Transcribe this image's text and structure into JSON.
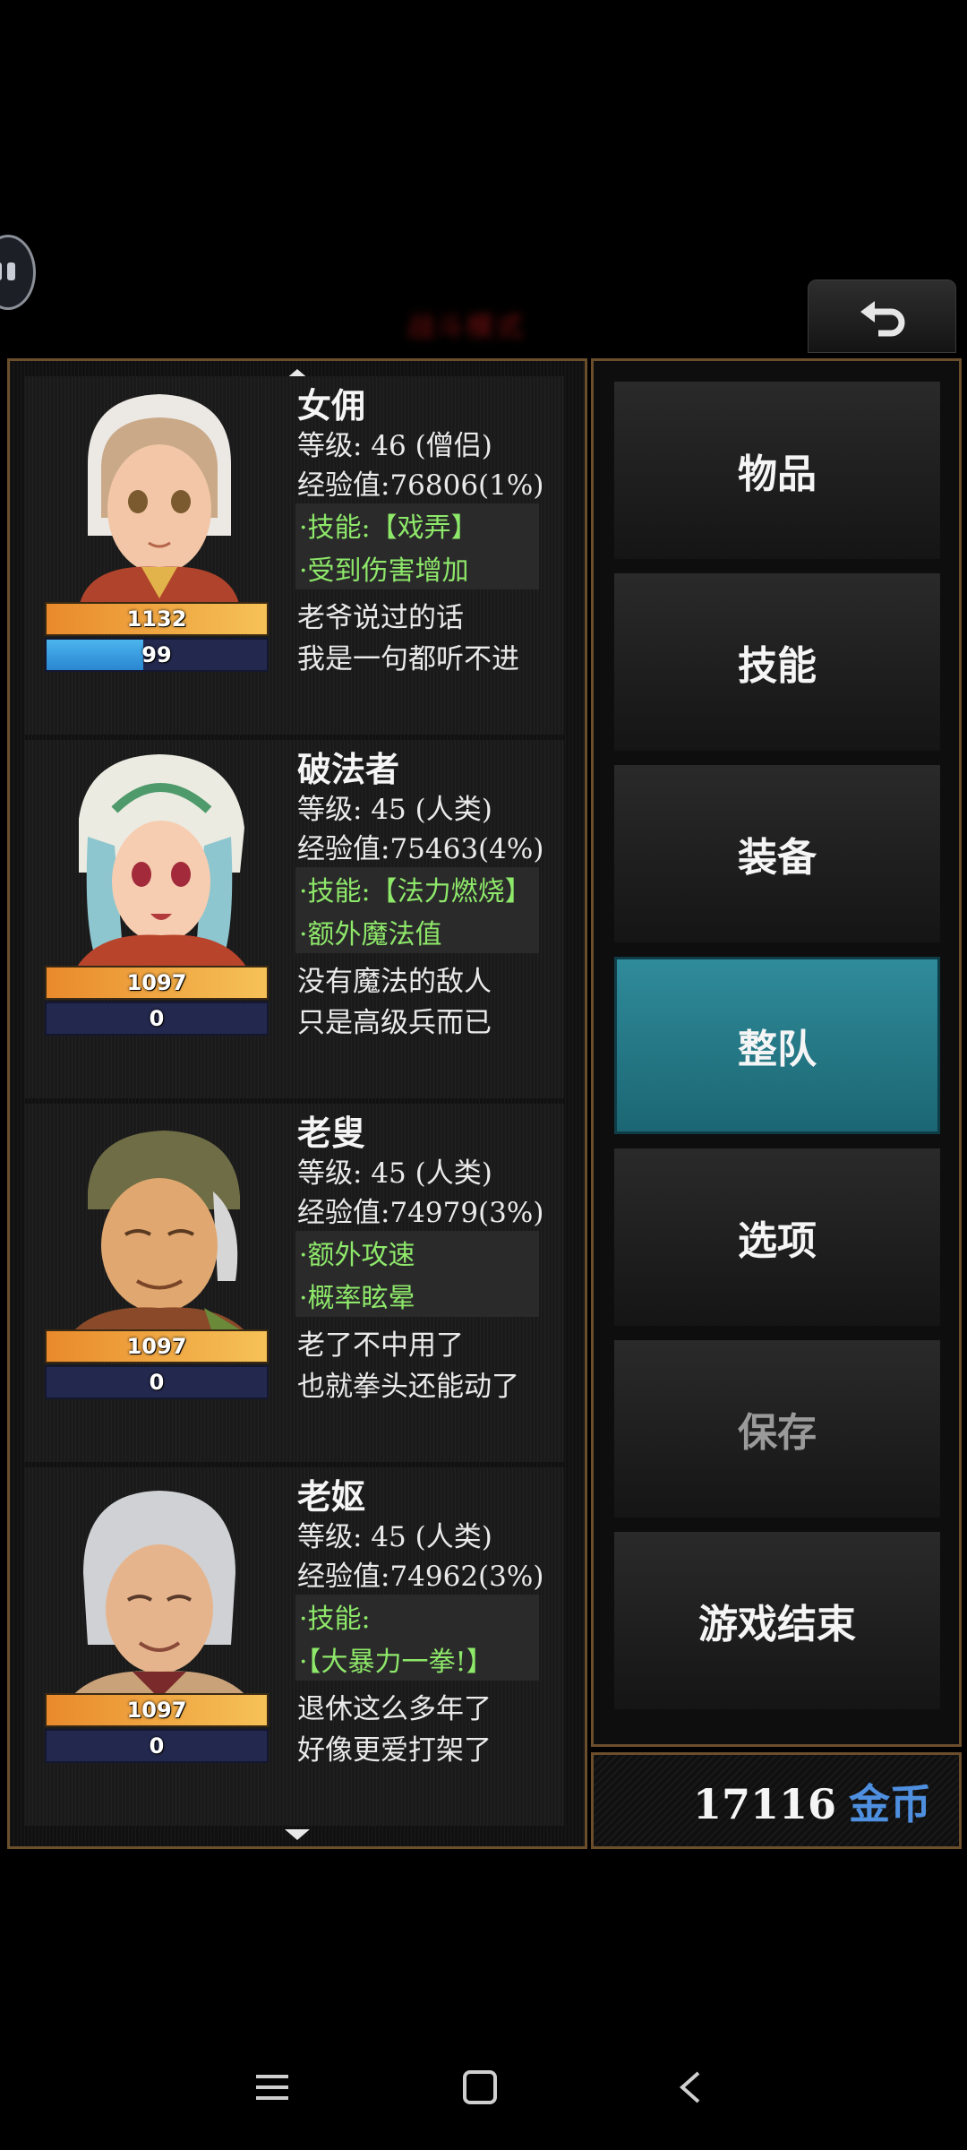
{
  "header": {
    "blurred_title": "战斗模式"
  },
  "characters": [
    {
      "name": "女佣",
      "level": "等级: 46 (僧侣)",
      "exp": "经验值:76806(1%)",
      "skill1": "·技能:【戏弄】",
      "skill2": "·受到伤害增加",
      "quote1": "老爷说过的话",
      "quote2": "我是一句都听不进",
      "hp": "1132",
      "mp": "99",
      "mp_fraction": 0.44
    },
    {
      "name": "破法者",
      "level": "等级: 45 (人类)",
      "exp": "经验值:75463(4%)",
      "skill1": "·技能:【法力燃烧】",
      "skill2": "·额外魔法值",
      "quote1": "没有魔法的敌人",
      "quote2": "只是高级兵而已",
      "hp": "1097",
      "mp": "0",
      "mp_fraction": 0
    },
    {
      "name": "老叟",
      "level": "等级: 45 (人类)",
      "exp": "经验值:74979(3%)",
      "skill1": "·额外攻速",
      "skill2": "·概率眩晕",
      "quote1": "老了不中用了",
      "quote2": "也就拳头还能动了",
      "hp": "1097",
      "mp": "0",
      "mp_fraction": 0
    },
    {
      "name": "老妪",
      "level": "等级: 45 (人类)",
      "exp": "经验值:74962(3%)",
      "skill1": "·技能:",
      "skill2": "·【大暴力一拳!】",
      "quote1": "退休这么多年了",
      "quote2": "好像更爱打架了",
      "hp": "1097",
      "mp": "0",
      "mp_fraction": 0
    }
  ],
  "menu": {
    "items": [
      "物品",
      "技能",
      "装备",
      "整队",
      "选项",
      "保存",
      "游戏结束"
    ],
    "active": "整队",
    "disabled": "保存"
  },
  "gold": {
    "amount": "17116",
    "unit": "金币"
  },
  "colors": {
    "hp_bar": "#f0a640",
    "mp_bar": "#3a9be0",
    "active_menu": "#2a7d8b",
    "border": "#6b4e2c",
    "skill_text": "#8ee86a",
    "gold_unit": "#4f8fe0"
  },
  "icons": [
    "back-arrow-icon",
    "scroll-up-icon",
    "scroll-down-icon",
    "menu-nav-icon",
    "home-nav-icon",
    "back-nav-icon"
  ]
}
